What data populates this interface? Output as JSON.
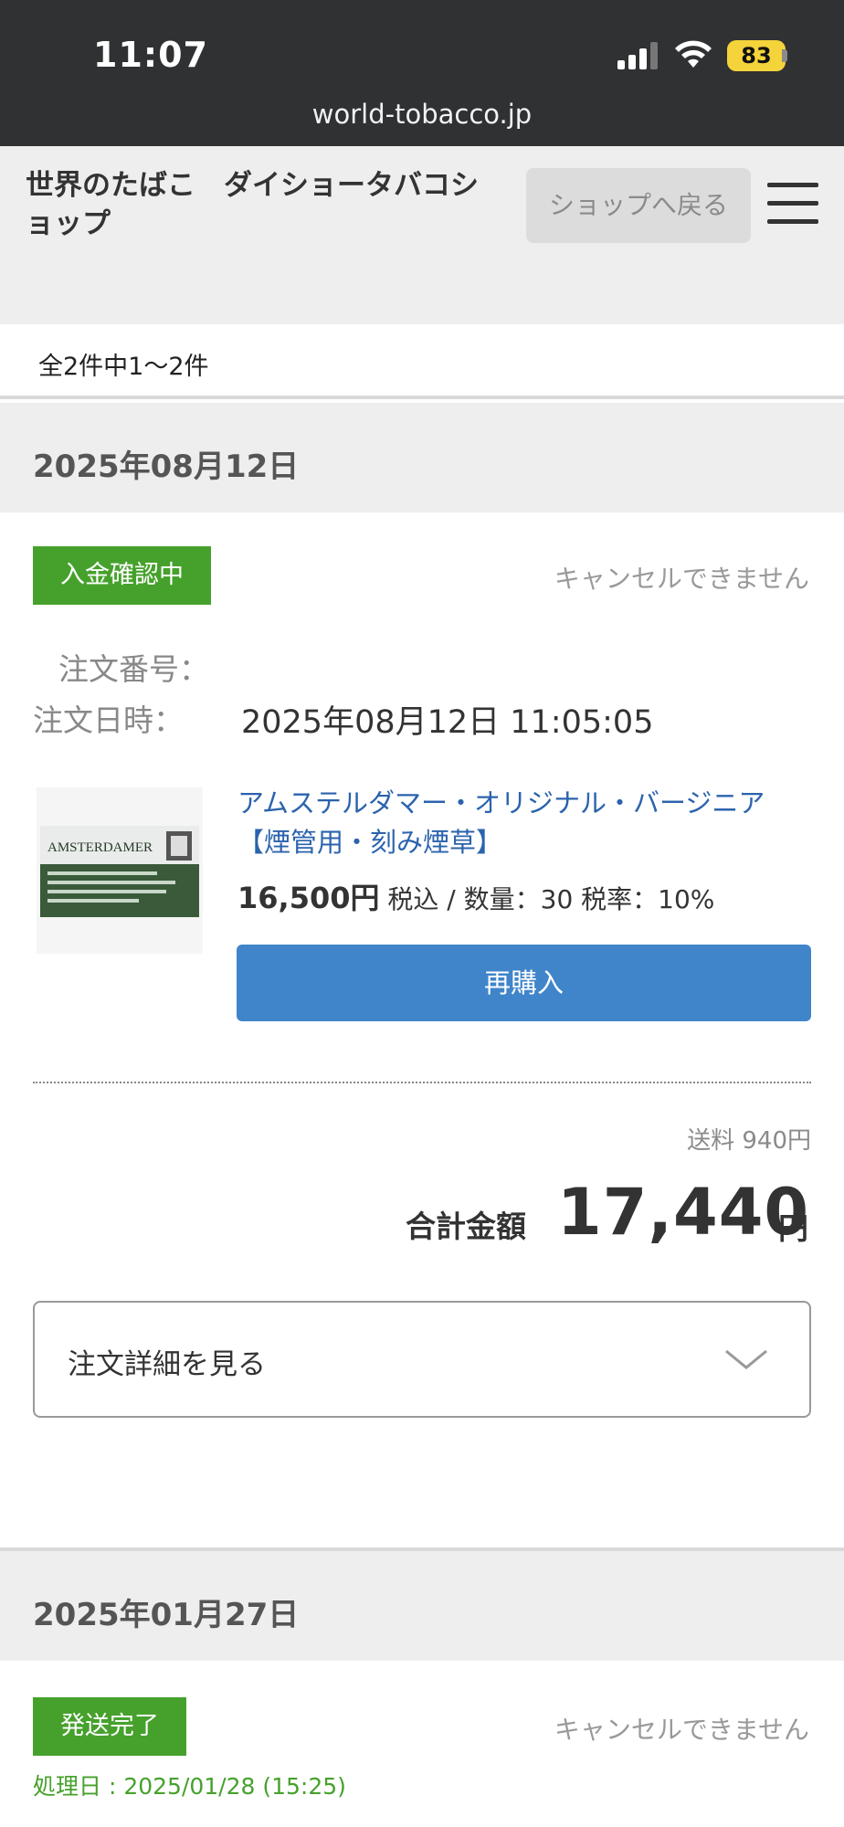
{
  "status_bar": {
    "time": "11:07",
    "battery": "83",
    "url": "world-tobacco.jp",
    "icons": [
      "signal-icon",
      "wifi-icon",
      "battery-icon"
    ]
  },
  "header": {
    "shop_title": "世界のたばこ　ダイショータバコショップ",
    "back_button": "ショップへ戻る",
    "menu_icon": "hamburger-menu-icon"
  },
  "list": {
    "count_text": "全2件中1～2件"
  },
  "orders": [
    {
      "date": "2025年08月12日",
      "status": "入金確認中",
      "cancel_text": "キャンセルできません",
      "order_number_label": "注文番号：",
      "order_number": "",
      "order_datetime_label": "注文日時：",
      "order_datetime": "2025年08月12日 11:05:05",
      "item": {
        "thumbnail_brand": "AMSTERDAMER",
        "name": "アムステルダマー・オリジナル・バージニア【煙管用・刻み煙草】",
        "price": "16,500円",
        "price_suffix": " 税込 / 数量：30 税率：10%",
        "rebuy_button": "再購入"
      },
      "shipping": "送料 940円",
      "total_label": "合計金額",
      "total": "17,440",
      "total_unit": "円",
      "details_toggle": "注文詳細を見る"
    },
    {
      "date": "2025年01月27日",
      "status": "発送完了",
      "cancel_text": "キャンセルできません",
      "processed": "処理日 : 2025/01/28 (15:25)"
    }
  ],
  "colors": {
    "status_bar_bg": "#2f3133",
    "header_bg": "#eeeeee",
    "badge_green": "#46a12c",
    "link_blue": "#2b63ad",
    "button_blue": "#4085ca",
    "battery_yellow": "#f4d33b"
  }
}
